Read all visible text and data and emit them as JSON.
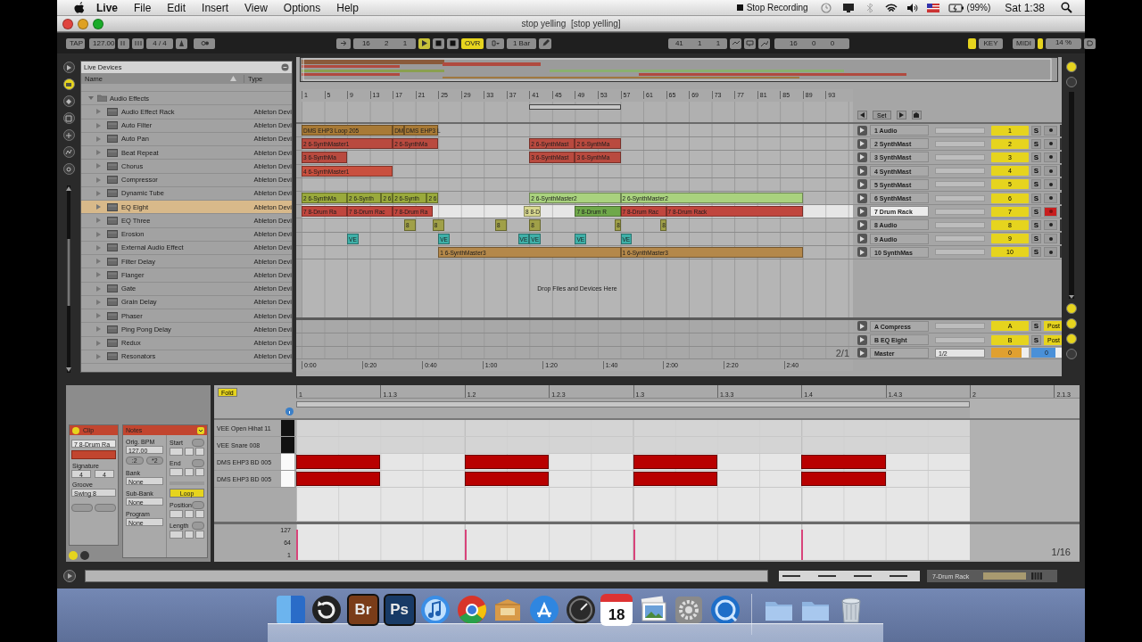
{
  "menu_bar": {
    "app": "Live",
    "items": [
      "File",
      "Edit",
      "Insert",
      "View",
      "Options",
      "Help"
    ],
    "recording": "Stop Recording",
    "battery": "(99%)",
    "clock": "Sat 1:38"
  },
  "window": {
    "title": "stop yelling  [stop yelling]"
  },
  "transport": {
    "tap": "TAP",
    "tempo": "127.00",
    "signature": "4 / 4",
    "position": "16 2 1",
    "overdub": {
      "label": "OVR",
      "on": true
    },
    "quantize": "1 Bar",
    "loop_start": "41 1 1",
    "loop_length": "16 0 0",
    "key": "KEY",
    "midi": "MIDI",
    "cpu": "14 %"
  },
  "browser": {
    "title": "Live Devices",
    "columns": [
      "Name",
      "Type"
    ],
    "folder": "Audio Effects",
    "items": [
      {
        "name": "Audio Effect Rack",
        "type": "Ableton Devi",
        "selected": false
      },
      {
        "name": "Auto Filter",
        "type": "Ableton Devi",
        "selected": false
      },
      {
        "name": "Auto Pan",
        "type": "Ableton Devi",
        "selected": false
      },
      {
        "name": "Beat Repeat",
        "type": "Ableton Devi",
        "selected": false
      },
      {
        "name": "Chorus",
        "type": "Ableton Devi",
        "selected": false
      },
      {
        "name": "Compressor",
        "type": "Ableton Devi",
        "selected": false
      },
      {
        "name": "Dynamic Tube",
        "type": "Ableton Devi",
        "selected": false
      },
      {
        "name": "EQ Eight",
        "type": "Ableton Devi",
        "selected": true
      },
      {
        "name": "EQ Three",
        "type": "Ableton Devi",
        "selected": false
      },
      {
        "name": "Erosion",
        "type": "Ableton Devi",
        "selected": false
      },
      {
        "name": "External Audio Effect",
        "type": "Ableton Devi",
        "selected": false
      },
      {
        "name": "Filter Delay",
        "type": "Ableton Devi",
        "selected": false
      },
      {
        "name": "Flanger",
        "type": "Ableton Devi",
        "selected": false
      },
      {
        "name": "Gate",
        "type": "Ableton Devi",
        "selected": false
      },
      {
        "name": "Grain Delay",
        "type": "Ableton Devi",
        "selected": false
      },
      {
        "name": "Phaser",
        "type": "Ableton Devi",
        "selected": false
      },
      {
        "name": "Ping Pong Delay",
        "type": "Ableton Devi",
        "selected": false
      },
      {
        "name": "Redux",
        "type": "Ableton Devi",
        "selected": false
      },
      {
        "name": "Resonators",
        "type": "Ableton Devi",
        "selected": false
      }
    ]
  },
  "arrangement": {
    "ruler": [
      "1",
      "5",
      "9",
      "13",
      "17",
      "21",
      "25",
      "29",
      "33",
      "37",
      "41",
      "45",
      "49",
      "53",
      "57",
      "61",
      "65",
      "69",
      "73",
      "77",
      "81",
      "85",
      "89",
      "93"
    ],
    "set_button": "Set",
    "tracks": [
      {
        "name": "1 Audio",
        "number": "1",
        "solo": "S",
        "selected": false,
        "armed": false,
        "clips": [
          {
            "label": "DMS EHP3 Loop 205",
            "color": "#a87a36"
          },
          {
            "label": "DM",
            "color": "#a87a36"
          },
          {
            "label": "DMS EHP3 L",
            "color": "#a87a36"
          }
        ]
      },
      {
        "name": "2 SynthMast",
        "number": "2",
        "solo": "S",
        "selected": false,
        "armed": false,
        "clips": [
          {
            "label": "2 6-SynthMaster1",
            "color": "#b94a3f"
          },
          {
            "label": "2 6-SynthMa",
            "color": "#b94a3f"
          },
          {
            "label": "2 6-SynthMast",
            "color": "#b94a3f"
          },
          {
            "label": "2 6-SynthMa",
            "color": "#b94a3f"
          }
        ]
      },
      {
        "name": "3 SynthMast",
        "number": "3",
        "solo": "S",
        "selected": false,
        "armed": false,
        "clips": [
          {
            "label": "3 6-SynthMa",
            "color": "#b94a3f"
          },
          {
            "label": "3 6-SynthMast",
            "color": "#b94a3f"
          },
          {
            "label": "3 6-SynthMa",
            "color": "#b94a3f"
          }
        ]
      },
      {
        "name": "4 SynthMast",
        "number": "4",
        "solo": "S",
        "selected": false,
        "armed": false,
        "clips": [
          {
            "label": "4 6-SynthMaster1",
            "color": "#c9503f"
          }
        ]
      },
      {
        "name": "5 SynthMast",
        "number": "5",
        "solo": "S",
        "selected": false,
        "armed": false
      },
      {
        "name": "6 SynthMast",
        "number": "6",
        "solo": "S",
        "selected": false,
        "armed": false,
        "clips": [
          {
            "label": "2 6-SynthMa",
            "color": "#9aaa3c"
          },
          {
            "label": "2 6-Synth",
            "color": "#9aaa3c"
          },
          {
            "label": "2 6",
            "color": "#9aaa3c"
          },
          {
            "label": "2 6-Synth",
            "color": "#9aaa3c"
          },
          {
            "label": "2 6",
            "color": "#9aaa3c"
          },
          {
            "label": "2 6-SynthMaster2",
            "color": "#a9d27e"
          },
          {
            "label": "2 6-SynthMaster2",
            "color": "#a9d27e"
          }
        ]
      },
      {
        "name": "7 Drum Rack",
        "number": "7",
        "solo": "S",
        "selected": true,
        "armed": true,
        "clips": [
          {
            "label": "7 8-Drum Ra",
            "color": "#c0463e"
          },
          {
            "label": "7 8-Drum Rac",
            "color": "#c0463e"
          },
          {
            "label": "7 8-Drum Ra",
            "color": "#c0463e"
          },
          {
            "label": "8 8-D",
            "color": "#d8d890"
          },
          {
            "label": "7 8-Drum R",
            "color": "#6fa84a"
          },
          {
            "label": "7 8-Drum Rac",
            "color": "#c0463e"
          },
          {
            "label": "7 8-Drum Rack",
            "color": "#c0463e"
          }
        ]
      },
      {
        "name": "8 Audio",
        "number": "8",
        "solo": "S",
        "selected": false,
        "armed": false,
        "clips": [
          {
            "label": "8",
            "color": "#a0a048"
          },
          {
            "label": "8",
            "color": "#a0a048"
          },
          {
            "label": "8",
            "color": "#a0a048"
          },
          {
            "label": "8",
            "color": "#a0a048"
          },
          {
            "label": "8",
            "color": "#a0a048"
          },
          {
            "label": "8",
            "color": "#a0a048"
          }
        ]
      },
      {
        "name": "9 Audio",
        "number": "9",
        "solo": "S",
        "selected": false,
        "armed": false,
        "clips": [
          {
            "label": "VE",
            "color": "#3fb0a8"
          },
          {
            "label": "VE",
            "color": "#3fb0a8"
          },
          {
            "label": "VE",
            "color": "#3fb0a8"
          },
          {
            "label": "VE",
            "color": "#3fb0a8"
          },
          {
            "label": "VE",
            "color": "#3fb0a8"
          },
          {
            "label": "VE",
            "color": "#3fb0a8"
          }
        ]
      },
      {
        "name": "10 SynthMas",
        "number": "10",
        "solo": "S",
        "selected": false,
        "armed": false,
        "clips": [
          {
            "label": "1 6-SynthMaster3",
            "color": "#b4884a"
          },
          {
            "label": "1 6-SynthMaster3",
            "color": "#b4884a"
          }
        ]
      }
    ],
    "drop_hint": "Drop Files and Devices Here",
    "returns": [
      {
        "name": "A Compress",
        "letter": "A",
        "solo": "S",
        "mode": "Post"
      },
      {
        "name": "B EQ Eight",
        "letter": "B",
        "solo": "S",
        "mode": "Post"
      }
    ],
    "master": {
      "name": "Master",
      "routing": "1/2",
      "volume": "0",
      "pan": "0"
    },
    "zoom": "2/1",
    "times": [
      "0:00",
      "0:20",
      "0:40",
      "1:00",
      "1:20",
      "1:40",
      "2:00",
      "2:20",
      "2:40"
    ]
  },
  "detail": {
    "clip": {
      "title": "Clip",
      "name": "7 8-Drum Ra",
      "signature_label": "Signature",
      "numerator": "4",
      "denominator": "4",
      "groove_label": "Groove",
      "groove": "Swing 8"
    },
    "notes": {
      "title": "Notes",
      "bpm_label": "Orig. BPM",
      "bpm": "127.00",
      "halve": ":2",
      "double": "*2",
      "bank_label": "Bank",
      "bank": "None",
      "sub_bank_label": "Sub-Bank",
      "sub_bank": "None",
      "program_label": "Program",
      "program": "None",
      "start_label": "Start",
      "end_label": "End",
      "loop": {
        "label": "Loop",
        "on": true
      },
      "position_label": "Position",
      "length_label": "Length"
    },
    "editor": {
      "fold": {
        "label": "Fold",
        "on": true
      },
      "ruler": [
        "1",
        "1.1.3",
        "1.2",
        "1.2.3",
        "1.3",
        "1.3.3",
        "1.4",
        "1.4.3",
        "2",
        "2.1.3"
      ],
      "rows": [
        {
          "name": "VEE Open Hihat 11",
          "black_key": true,
          "steps": [
            false,
            false,
            false,
            false,
            false,
            false,
            false,
            false
          ]
        },
        {
          "name": "VEE Snare 008",
          "black_key": true,
          "steps": [
            false,
            false,
            false,
            false,
            false,
            false,
            false,
            false
          ]
        },
        {
          "name": "DMS EHP3 BD 005",
          "black_key": false,
          "steps": [
            true,
            false,
            true,
            false,
            true,
            false,
            true,
            false
          ]
        },
        {
          "name": "DMS EHP3 BD 005",
          "black_key": false,
          "steps": [
            true,
            false,
            true,
            false,
            true,
            false,
            true,
            false
          ]
        }
      ],
      "velocity_ticks": [
        "127",
        "64",
        "1"
      ],
      "grid": "1/16"
    }
  },
  "status_bar": {
    "track": "7-Drum Rack"
  },
  "dock": [
    {
      "kind": "split"
    },
    {
      "kind": "restore"
    },
    {
      "kind": "tile",
      "label": "Br",
      "color": "#7a3c18"
    },
    {
      "kind": "tile",
      "label": "Ps",
      "color": "#183a66"
    },
    {
      "kind": "music"
    },
    {
      "kind": "wheel"
    },
    {
      "kind": "box"
    },
    {
      "kind": "store"
    },
    {
      "kind": "gauge"
    },
    {
      "kind": "calendar",
      "label": "18"
    },
    {
      "kind": "photos"
    },
    {
      "kind": "gear"
    },
    {
      "kind": "globe"
    },
    {
      "kind": "separator"
    },
    {
      "kind": "folder"
    },
    {
      "kind": "folder"
    },
    {
      "kind": "trash"
    }
  ]
}
